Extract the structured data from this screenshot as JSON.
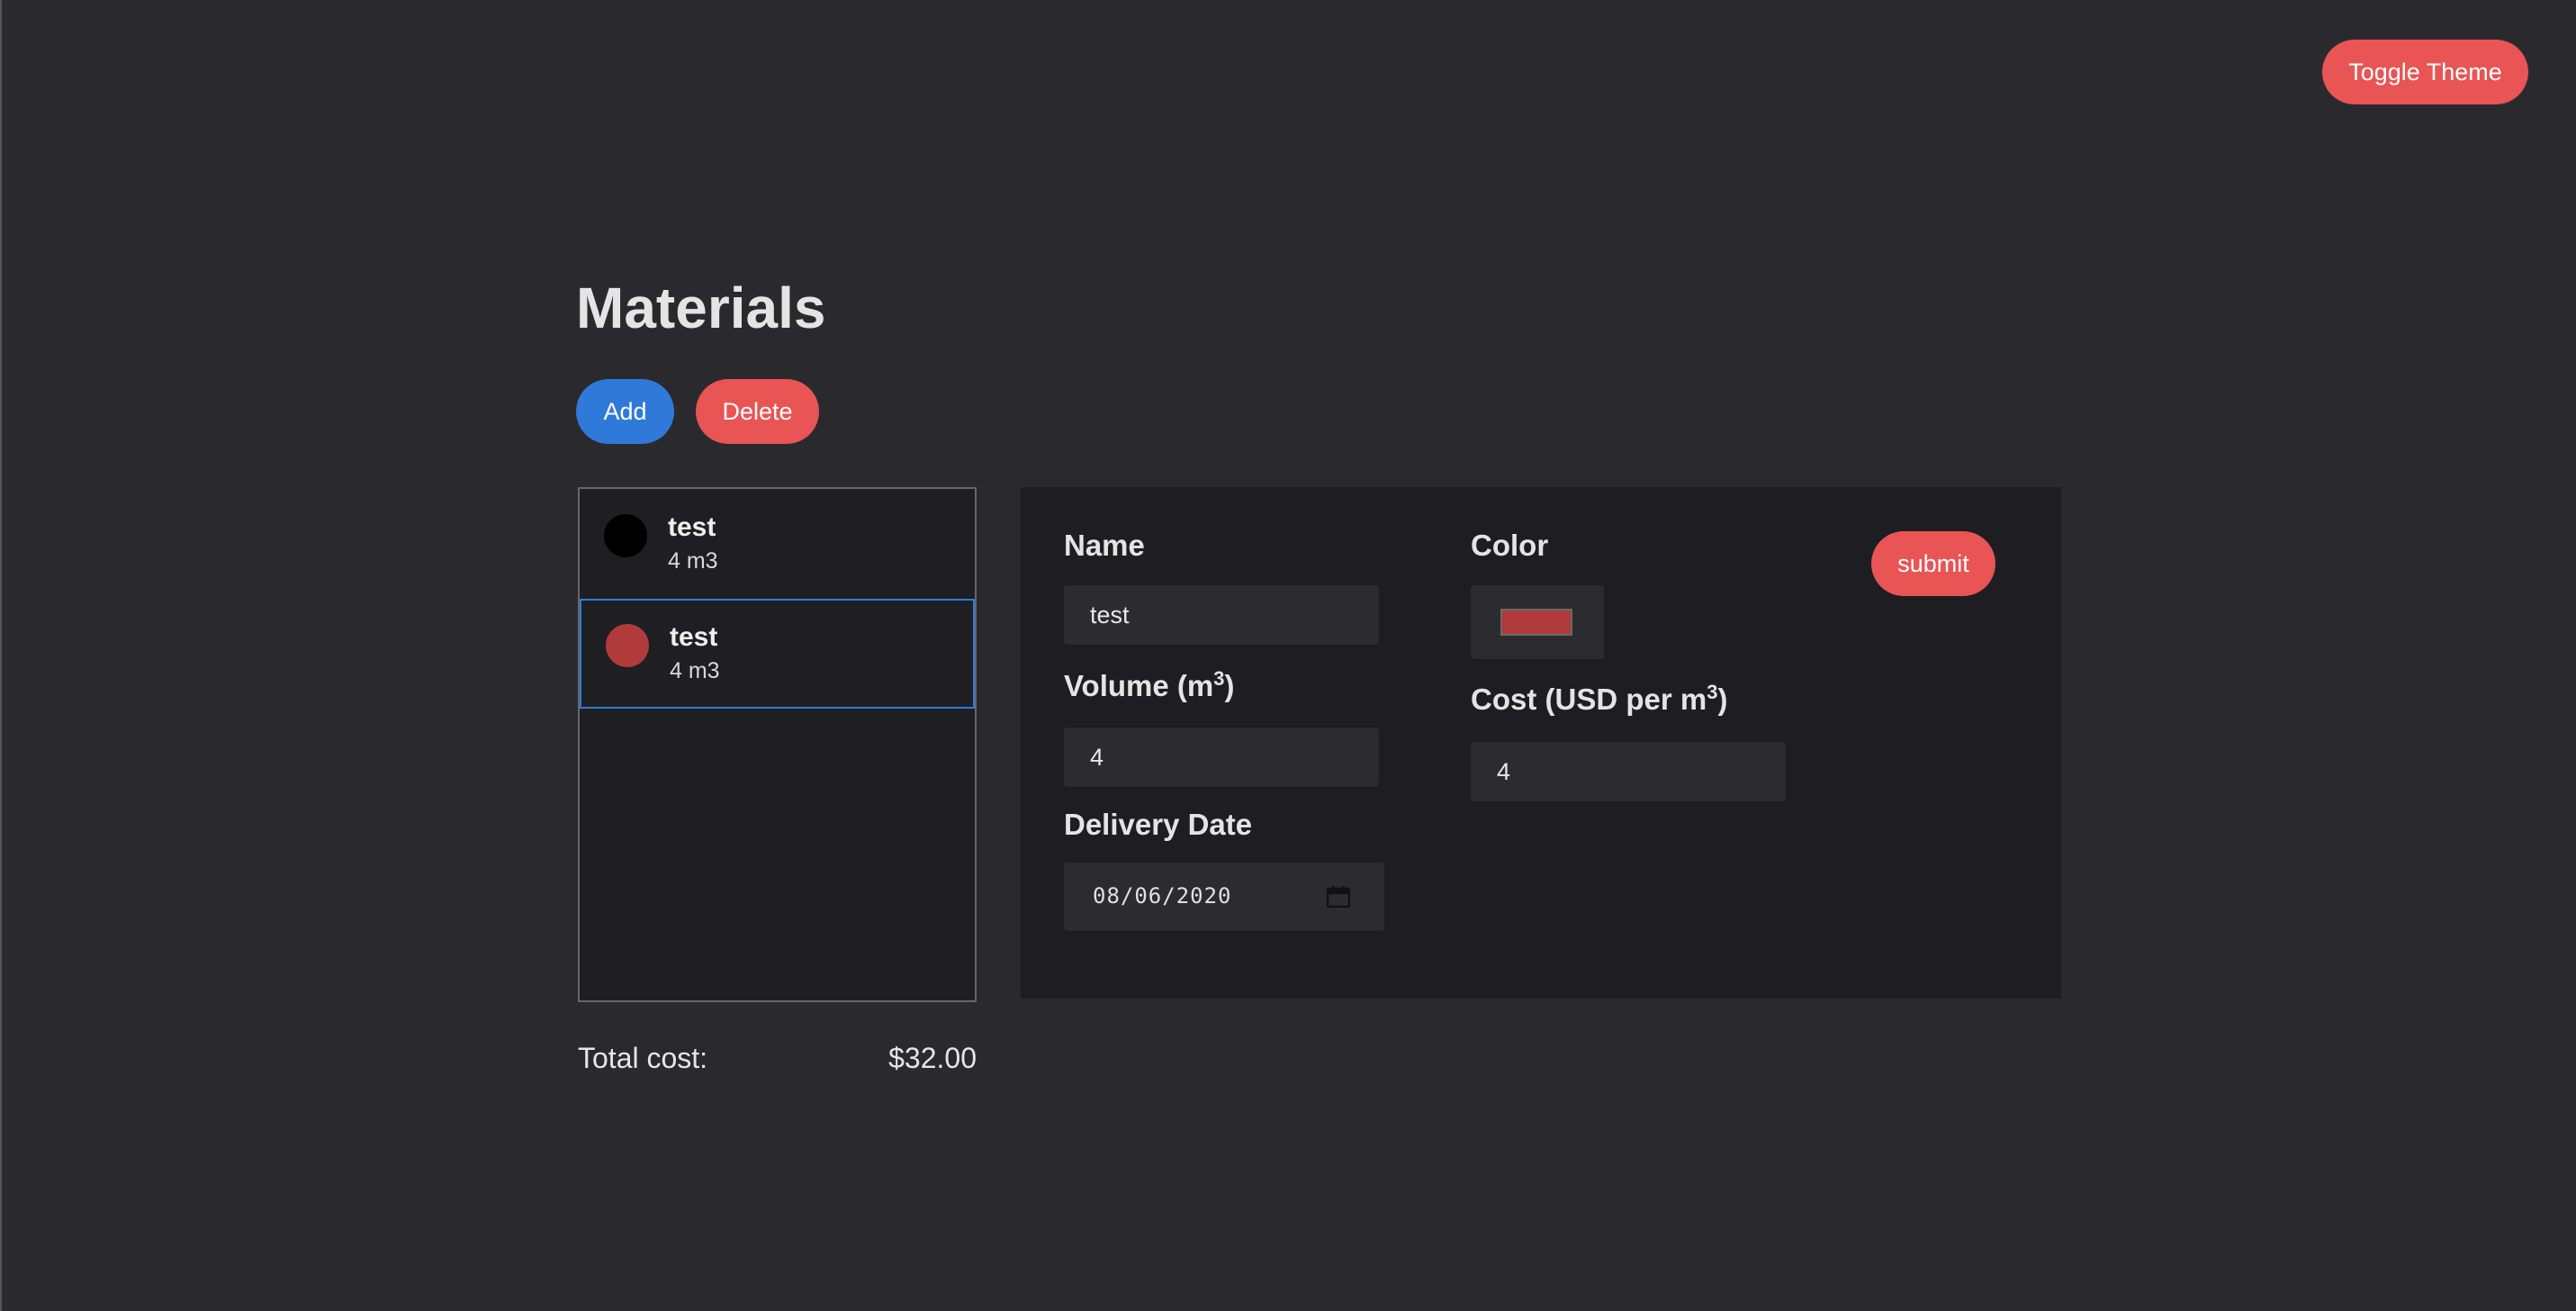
{
  "header": {
    "toggle_theme_label": "Toggle Theme"
  },
  "page": {
    "title": "Materials"
  },
  "toolbar": {
    "add_label": "Add",
    "delete_label": "Delete"
  },
  "materials": [
    {
      "name": "test",
      "volume": "4 m3",
      "color": "#000000",
      "selected": false
    },
    {
      "name": "test",
      "volume": "4 m3",
      "color": "#b13a3a",
      "selected": true
    }
  ],
  "form": {
    "name_label": "Name",
    "name_value": "test",
    "volume_label_prefix": "Volume (m",
    "volume_label_sup": "3",
    "volume_label_suffix": ")",
    "volume_value": "4",
    "delivery_label": "Delivery Date",
    "delivery_value": "08/06/2020",
    "color_label": "Color",
    "color_value": "#b13a3a",
    "cost_label_prefix": "Cost (USD per m",
    "cost_label_sup": "3",
    "cost_label_suffix": ")",
    "cost_value": "4",
    "submit_label": "submit"
  },
  "summary": {
    "total_label": "Total cost:",
    "total_value": "$32.00"
  },
  "colors": {
    "accent_red": "#e95454",
    "accent_blue": "#2f7ad8",
    "background": "#2a2a2e",
    "panel": "#1e1e22"
  },
  "icons": {
    "date_picker": "calendar-icon"
  }
}
